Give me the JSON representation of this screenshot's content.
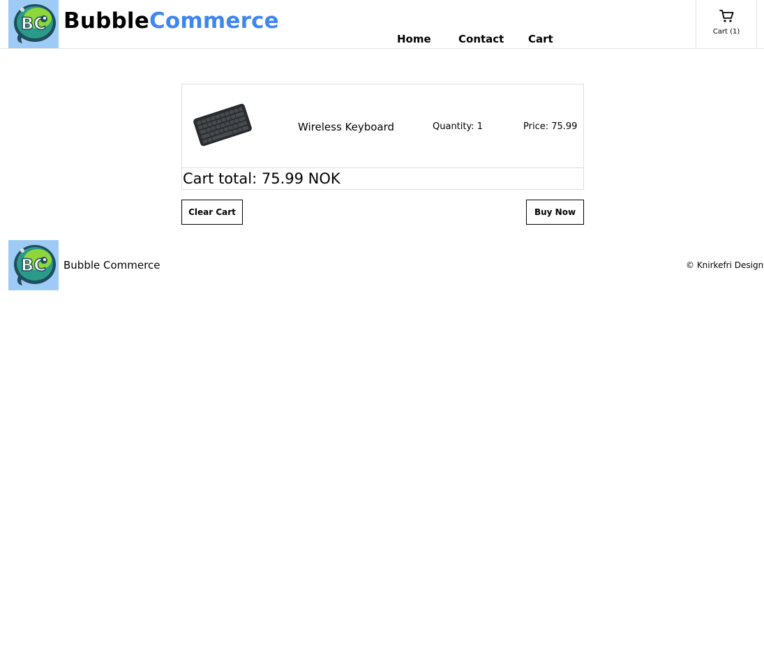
{
  "header": {
    "brand_part1": "Bubble",
    "brand_part2": "Commerce",
    "logo_text": "BC",
    "nav": [
      {
        "label": "Home"
      },
      {
        "label": "Contact"
      },
      {
        "label": "Cart"
      }
    ],
    "cart_widget_label": "Cart (1)",
    "icons": {
      "cart": "shopping-cart-icon"
    }
  },
  "cart": {
    "items": [
      {
        "name": "Wireless Keyboard",
        "quantity_label": "Quantity: 1",
        "price_label": "Price: 75.99"
      }
    ],
    "total_label": "Cart total: 75.99 NOK",
    "clear_label": "Clear Cart",
    "buy_label": "Buy Now"
  },
  "footer": {
    "brand": "Bubble Commerce",
    "copyright": "© Knirkefri Design"
  },
  "colors": {
    "brand_accent": "#3f86f0",
    "logo_bg": "#9ecbf5",
    "border": "#dddddd"
  }
}
